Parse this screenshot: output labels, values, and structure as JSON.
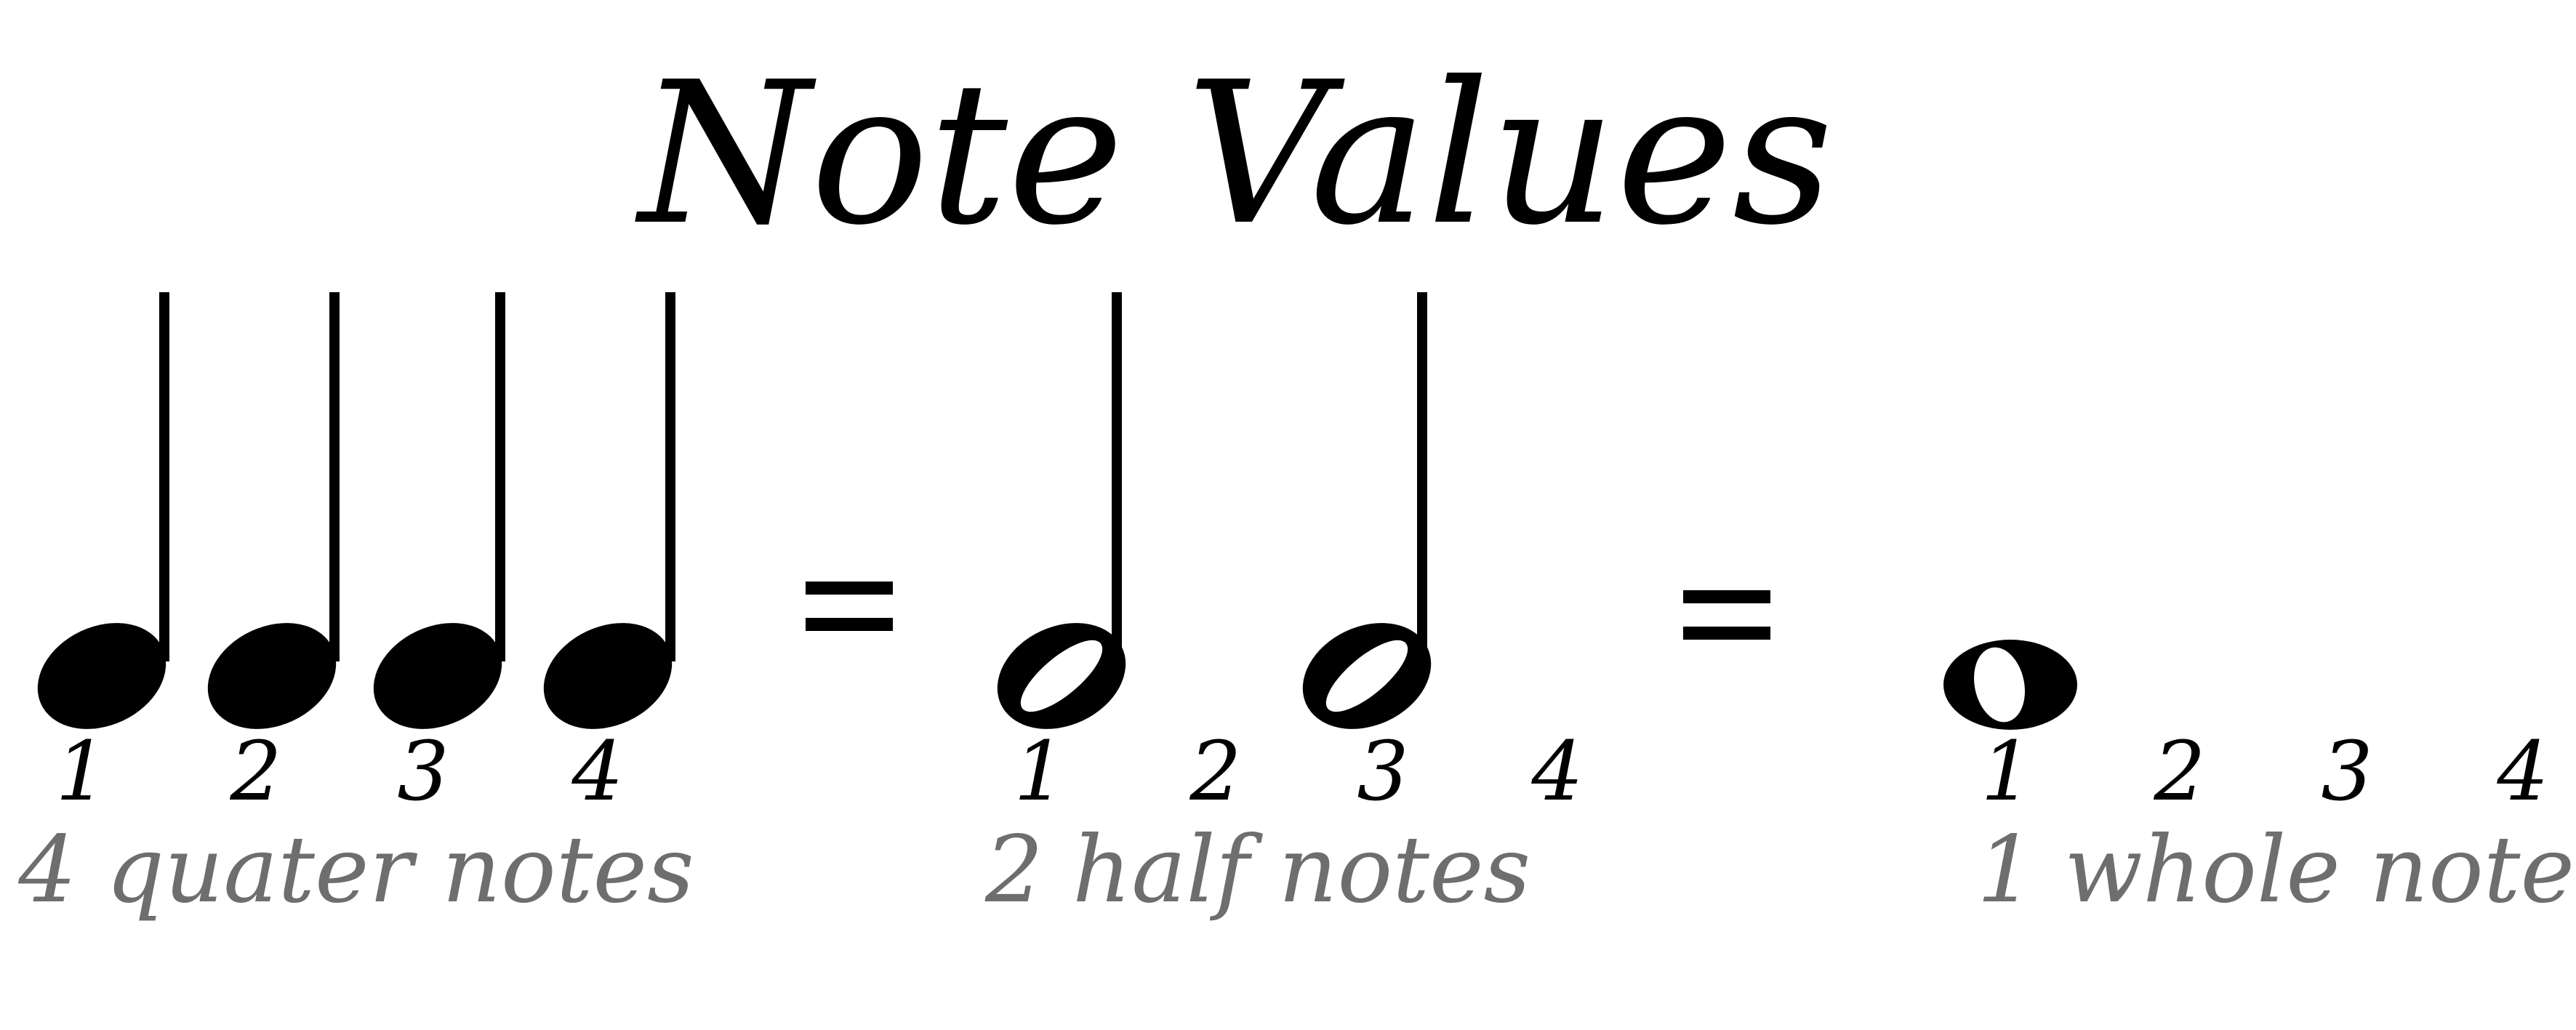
{
  "title": "Note Values",
  "colors": {
    "ink": "#000000",
    "caption": "#6e6e6e",
    "background": "#ffffff"
  },
  "icons": {
    "quarter": "quarter-note-icon",
    "half": "half-note-icon",
    "whole": "whole-note-icon",
    "equals": "equals-sign-icon"
  },
  "groups": [
    {
      "note_type": "quarter",
      "note_count": 4,
      "counts": [
        "1",
        "2",
        "3",
        "4"
      ],
      "caption": "4 quater notes"
    },
    {
      "note_type": "half",
      "note_count": 2,
      "counts": [
        "1",
        "2",
        "3",
        "4"
      ],
      "caption": "2 half notes"
    },
    {
      "note_type": "whole",
      "note_count": 1,
      "counts": [
        "1",
        "2",
        "3",
        "4"
      ],
      "caption": "1 whole note"
    }
  ]
}
